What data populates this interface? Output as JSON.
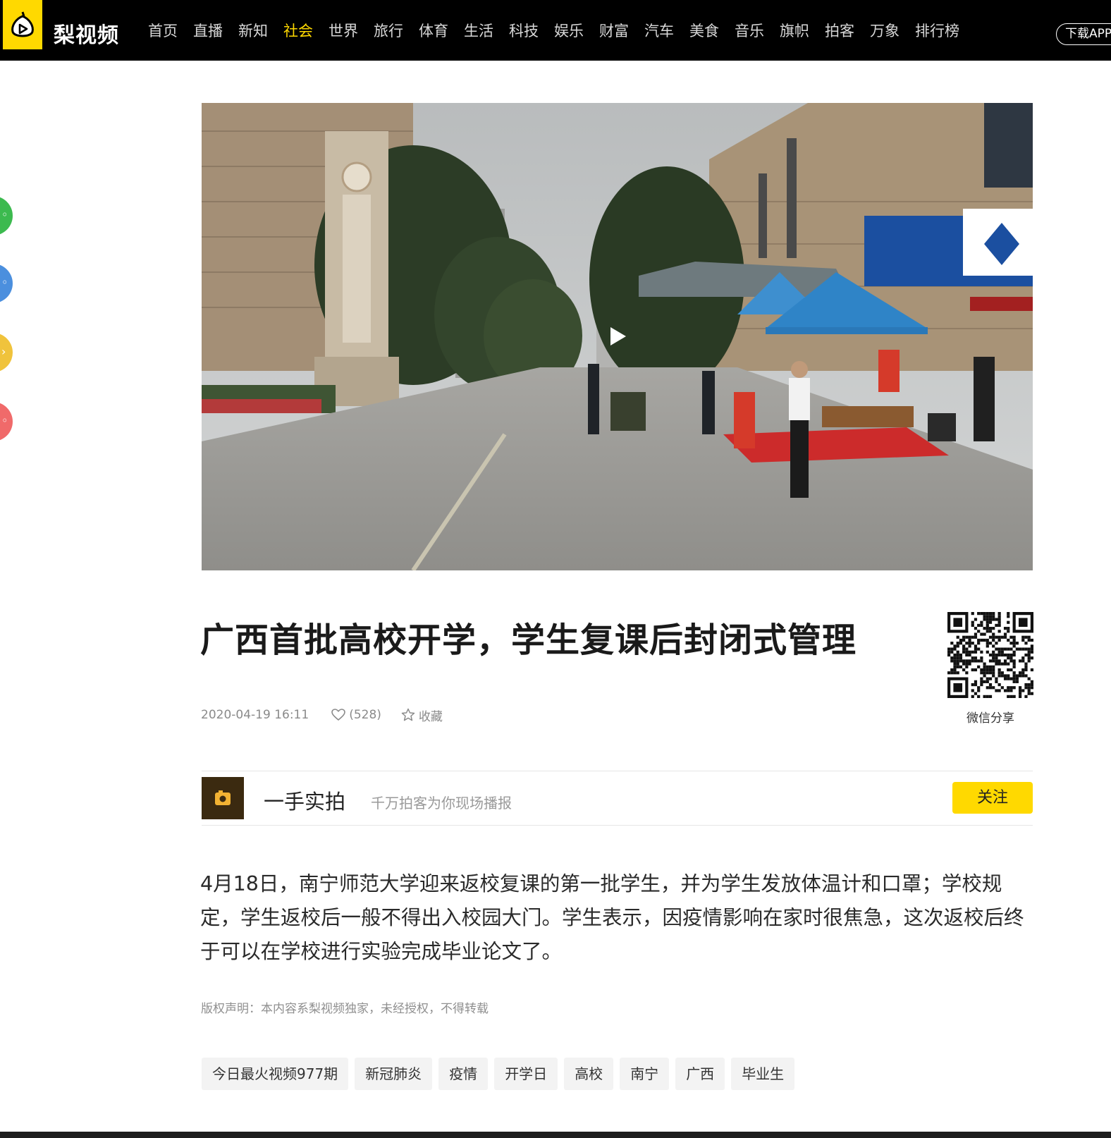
{
  "header": {
    "logo_text": "梨视频",
    "nav": [
      "首页",
      "直播",
      "新知",
      "社会",
      "世界",
      "旅行",
      "体育",
      "生活",
      "科技",
      "娱乐",
      "财富",
      "汽车",
      "美食",
      "音乐",
      "旗帜",
      "拍客",
      "万象",
      "排行榜"
    ],
    "active_nav": "社会",
    "download_label": "下载APP",
    "accent_color": "#ffd900"
  },
  "side_share": [
    {
      "name": "wechat-share-icon",
      "color": "#3cba4f"
    },
    {
      "name": "qq-share-icon",
      "color": "#4b8fde"
    },
    {
      "name": "qzone-share-icon",
      "color": "#f0c33c"
    },
    {
      "name": "weibo-share-icon",
      "color": "#f06a6a"
    }
  ],
  "video": {
    "play_icon": "play-icon"
  },
  "article": {
    "title": "广西首批高校开学，学生复课后封闭式管理",
    "date": "2020-04-19 16:11",
    "like_count": "(528)",
    "favorite_label": "收藏",
    "qr_label": "微信分享",
    "summary": "4月18日，南宁师范大学迎来返校复课的第一批学生，并为学生发放体温计和口罩；学校规定，学生返校后一般不得出入校园大门。学生表示，因疫情影响在家时很焦急，这次返校后终于可以在学校进行实验完成毕业论文了。",
    "copyright": "版权声明：本内容系梨视频独家，未经授权，不得转载"
  },
  "author": {
    "name": "一手实拍",
    "description": "千万拍客为你现场播报",
    "follow_label": "关注"
  },
  "tags": [
    "今日最火视频977期",
    "新冠肺炎",
    "疫情",
    "开学日",
    "高校",
    "南宁",
    "广西",
    "毕业生"
  ]
}
